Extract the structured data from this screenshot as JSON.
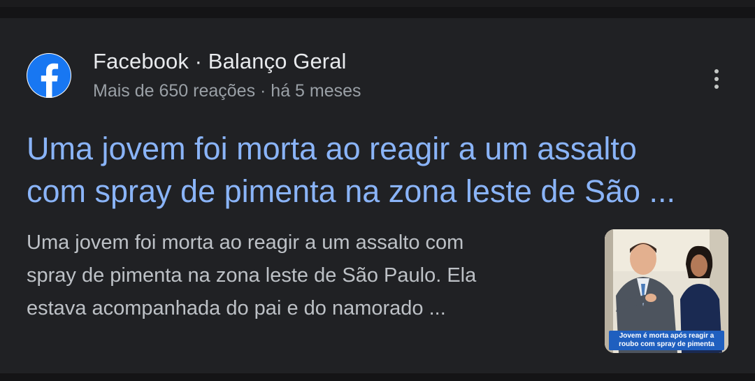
{
  "result": {
    "source": {
      "name": "Facebook · Balanço Geral",
      "meta": "Mais de 650 reações · há 5 meses",
      "logo_icon": "facebook-icon",
      "logo_color": "#1877f2"
    },
    "headline_lines": [
      "Uma jovem foi morta ao reagir a um assalto",
      "com spray de pimenta na zona leste de São ..."
    ],
    "snippet_lines": [
      "Uma jovem foi morta ao reagir a um assalto com",
      "spray de pimenta na zona leste de São Paulo. Ela",
      "estava acompanhada do pai e do namorado ..."
    ],
    "thumbnail": {
      "caption": "Jovem é morta após reagir a roubo com spray de pimenta"
    },
    "menu_icon": "more-vert-icon",
    "colors": {
      "background": "#202124",
      "headline": "#8ab4f8",
      "snippet": "#bdc1c6",
      "meta": "#9aa0a6"
    }
  }
}
